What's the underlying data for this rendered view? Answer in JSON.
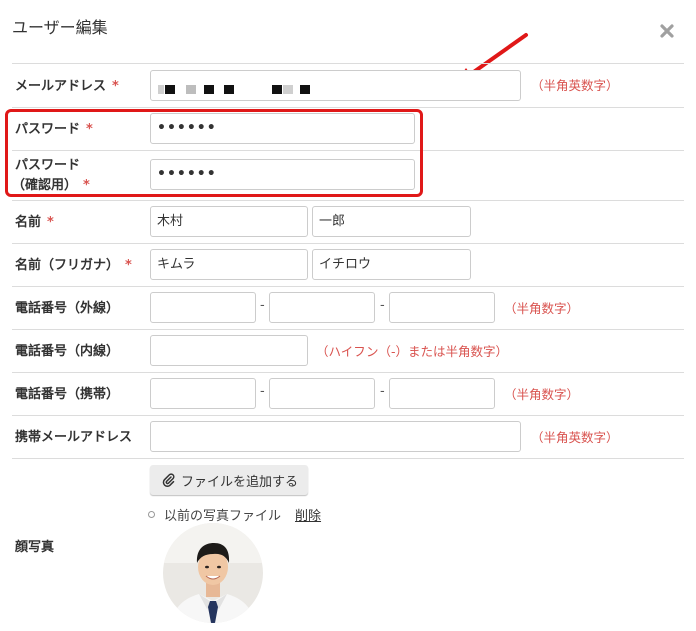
{
  "modal": {
    "title": "ユーザー編集",
    "close_icon": "close-icon"
  },
  "required_mark": "*",
  "email": {
    "label": "メールアドレス",
    "hint": "（半角英数字）",
    "masked": true
  },
  "password": {
    "label": "パスワード",
    "value": "••••••"
  },
  "password_confirm": {
    "label_line1": "パスワード",
    "label_line2": "（確認用）",
    "value": "••••••"
  },
  "name": {
    "label": "名前",
    "last": "木村",
    "first": "一郎"
  },
  "name_kana": {
    "label": "名前（フリガナ）",
    "last": "キムラ",
    "first": "イチロウ"
  },
  "phone_external": {
    "label": "電話番号（外線）",
    "separator": "-",
    "hint": "（半角数字）",
    "parts": [
      "",
      "",
      ""
    ]
  },
  "phone_internal": {
    "label": "電話番号（内線）",
    "hint": "（ハイフン（-）または半角数字）",
    "value": ""
  },
  "phone_mobile": {
    "label": "電話番号（携帯）",
    "separator": "-",
    "hint": "（半角数字）",
    "parts": [
      "",
      "",
      ""
    ]
  },
  "mobile_email": {
    "label": "携帯メールアドレス",
    "hint": "（半角英数字）",
    "value": ""
  },
  "photo": {
    "label": "顔写真",
    "add_button": "ファイルを追加する",
    "previous_file": "以前の写真ファイル",
    "delete_link": "削除"
  },
  "colors": {
    "required": "#d9534f",
    "highlight": "#e01818",
    "arrow": "#e01818"
  }
}
